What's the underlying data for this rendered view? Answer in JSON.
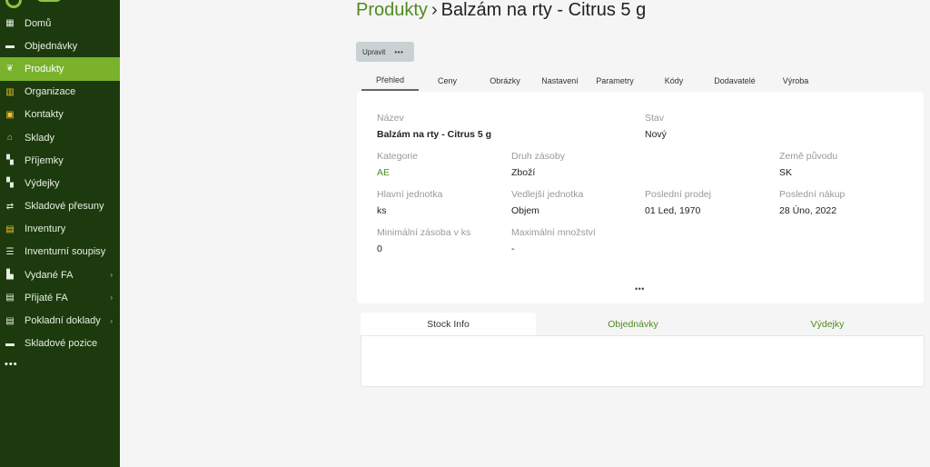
{
  "sidebar": {
    "items": [
      {
        "label": "Domů",
        "icon": "dashboard-icon",
        "glyph": "▦",
        "active": false
      },
      {
        "label": "Objednávky",
        "icon": "orders-icon",
        "glyph": "▬",
        "active": false
      },
      {
        "label": "Produkty",
        "icon": "leaf-icon",
        "glyph": "❦",
        "active": true
      },
      {
        "label": "Organizace",
        "icon": "building-icon",
        "glyph": "▥",
        "active": false
      },
      {
        "label": "Kontakty",
        "icon": "contacts-icon",
        "glyph": "▣",
        "active": false
      },
      {
        "label": "Sklady",
        "icon": "warehouse-icon",
        "glyph": "⌂",
        "active": false
      },
      {
        "label": "Příjemky",
        "icon": "truck-in-icon",
        "glyph": "▚",
        "active": false
      },
      {
        "label": "Výdejky",
        "icon": "truck-out-icon",
        "glyph": "▚",
        "active": false
      },
      {
        "label": "Skladové přesuny",
        "icon": "transfer-icon",
        "glyph": "⇄",
        "active": false
      },
      {
        "label": "Inventury",
        "icon": "clipboard-icon",
        "glyph": "▤",
        "active": false
      },
      {
        "label": "Inventurní soupisy",
        "icon": "list-icon",
        "glyph": "☰",
        "active": false
      },
      {
        "label": "Vydané FA",
        "icon": "invoice-out-icon",
        "glyph": "▙",
        "active": false,
        "arrow": "›"
      },
      {
        "label": "Přijaté FA",
        "icon": "invoice-in-icon",
        "glyph": "▤",
        "active": false,
        "arrow": "›"
      },
      {
        "label": "Pokladní doklady",
        "icon": "receipt-icon",
        "glyph": "▤",
        "active": false,
        "arrow": "›"
      },
      {
        "label": "Skladové pozice",
        "icon": "box-icon",
        "glyph": "▬",
        "active": false
      }
    ],
    "more": "•••"
  },
  "header": {
    "crumb": "Produkty",
    "separator": "›",
    "title": "Balzám na rty - Citrus 5 g"
  },
  "toolbar": {
    "edit_label": "Upravit",
    "more_label": "•••"
  },
  "tabs": [
    "Přehled",
    "Ceny",
    "Obrázky",
    "Nastavení",
    "Parametry",
    "Kódy",
    "Dodavatelé",
    "Výroba"
  ],
  "details": {
    "nazev": {
      "label": "Název",
      "value": "Balzám na rty - Citrus 5 g"
    },
    "stav": {
      "label": "Stav",
      "value": "Nový"
    },
    "kategorie": {
      "label": "Kategorie",
      "value": "AE"
    },
    "druh": {
      "label": "Druh zásoby",
      "value": "Zboží"
    },
    "zeme": {
      "label": "Země původu",
      "value": "SK"
    },
    "hlavni": {
      "label": "Hlavní jednotka",
      "value": "ks"
    },
    "vedlejsi": {
      "label": "Vedlejší jednotka",
      "value": "Objem"
    },
    "prodej": {
      "label": "Poslední prodej",
      "value": "01 Led, 1970"
    },
    "nakup": {
      "label": "Poslední nákup",
      "value": "28 Úno, 2022"
    },
    "minimalni": {
      "label": "Minimální zásoba v ks",
      "value": "0"
    },
    "maximalni": {
      "label": "Maximální množství",
      "value": "-"
    },
    "more": "•••"
  },
  "bottom_tabs": {
    "stock": "Stock Info",
    "orders": "Objednávky",
    "issues": "Výdejky"
  },
  "colors": {
    "sidebar": "#1c3a0e",
    "accent": "#7ab22b",
    "link": "#4f8a1f"
  }
}
